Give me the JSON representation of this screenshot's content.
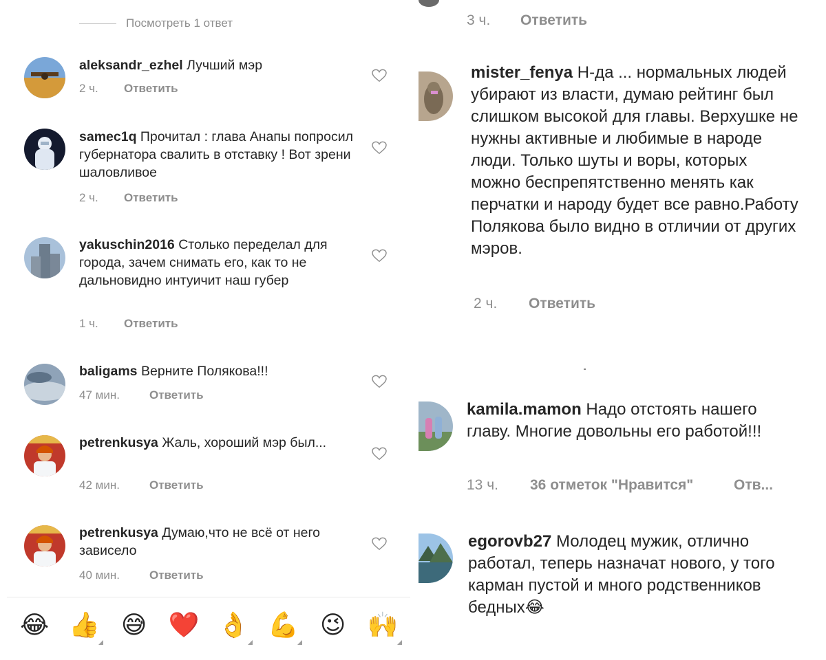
{
  "left": {
    "view_replies": "Посмотреть 1 ответ",
    "comments": [
      {
        "user": "aleksandr_ezhel",
        "text": "Лучший мэр",
        "time": "2 ч.",
        "reply": "Ответить"
      },
      {
        "user": "samec1q",
        "text": "Прочитал : глава Анапы попросил губернатора свалить в отставку ! Вот зрени  шаловливое",
        "time": "2 ч.",
        "reply": "Ответить"
      },
      {
        "user": "yakuschin2016",
        "text": "Столько переделал для города, зачем снимать его, как то не дальновидно интуичит наш губер",
        "time": "1 ч.",
        "reply": "Ответить"
      },
      {
        "user": "baligams",
        "text": "Верните Полякова!!!",
        "time": "47 мин.",
        "reply": "Ответить"
      },
      {
        "user": "petrenkusya",
        "text": "Жаль, хороший мэр был...",
        "time": "42 мин.",
        "reply": "Ответить"
      },
      {
        "user": "petrenkusya",
        "text": "Думаю,что не всё от него зависело",
        "time": "40 мин.",
        "reply": "Ответить"
      }
    ],
    "emoji_bar": [
      "😂",
      "👍",
      "😅",
      "❤️",
      "👌",
      "💪",
      "😉",
      "🙌"
    ]
  },
  "right": {
    "top_meta": {
      "time": "3 ч.",
      "reply": "Ответить"
    },
    "comments": [
      {
        "user": "mister_fenya",
        "text": "Н-да ... нормальных людей убирают из власти, думаю рейтинг был слишком высокой для главы. Верхушке не нужны активные и любимые в народе люди. Только шуты и воры, которых можно беспрепятственно менять как перчатки и народу будет все равно.Работу Полякова было видно в отличии от других мэров.",
        "time": "2 ч.",
        "reply": "Ответить"
      },
      {
        "user": "kamila.mamon",
        "text": "Надо отстоять нашего главу. Многие довольны его работой!!!",
        "time": "13 ч.",
        "likes": "36 отметок \"Нравится\"",
        "reply": "Отв..."
      },
      {
        "user": "egorovb27",
        "text": "Молодец мужик, отлично работал, теперь назначат нового, у того карман пустой и много родственников бедных😂"
      }
    ]
  },
  "colors": {
    "text": "#262626",
    "muted": "#8e8e8e",
    "divider": "#e8e8e8"
  }
}
